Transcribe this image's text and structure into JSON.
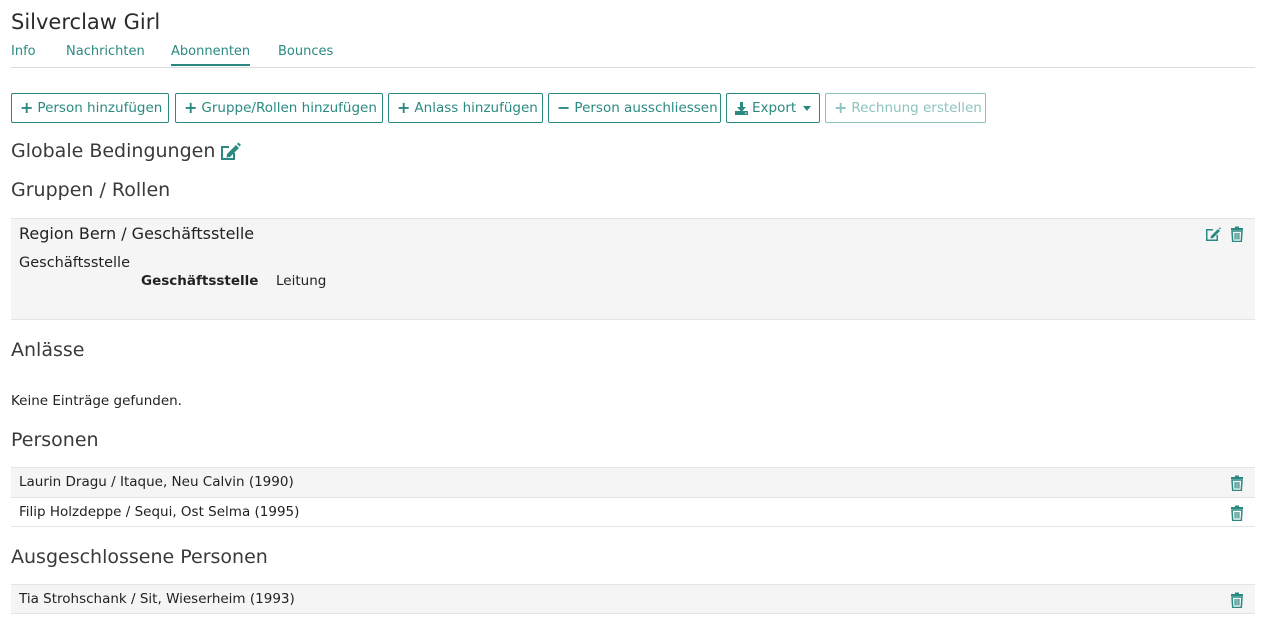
{
  "page": {
    "title": "Silverclaw Girl"
  },
  "tabs": [
    {
      "label": "Info"
    },
    {
      "label": "Nachrichten"
    },
    {
      "label": "Abonnenten"
    },
    {
      "label": "Bounces"
    }
  ],
  "toolbar": {
    "add_person": "Person hinzufügen",
    "add_group_roles": "Gruppe/Rollen hinzufügen",
    "add_event": "Anlass hinzufügen",
    "exclude_person": "Person ausschliessen",
    "export": "Export",
    "create_invoice": "Rechnung erstellen"
  },
  "sections": {
    "global_conditions": "Globale Bedingungen",
    "groups_roles": "Gruppen / Rollen",
    "events": "Anlässe",
    "persons": "Personen",
    "excluded_persons": "Ausgeschlossene Personen"
  },
  "group": {
    "title": "Region Bern / Geschäftsstelle",
    "subtitle": "Geschäftsstelle",
    "role_label": "Geschäftsstelle",
    "role_value": "Leitung"
  },
  "events_empty": "Keine Einträge gefunden.",
  "persons": [
    {
      "name": "Laurin Dragu / Itaque, Neu Calvin (1990)"
    },
    {
      "name": "Filip Holzdeppe / Sequi, Ost Selma (1995)"
    }
  ],
  "excluded_persons": [
    {
      "name": "Tia Strohschank / Sit, Wieserheim (1993)"
    }
  ],
  "colors": {
    "accent": "#2a8a82",
    "accent_disabled": "#8cc3be"
  },
  "icons": {
    "plus": "plus-icon",
    "minus": "minus-icon",
    "download": "download-icon",
    "edit": "edit-icon",
    "trash": "trash-icon"
  }
}
